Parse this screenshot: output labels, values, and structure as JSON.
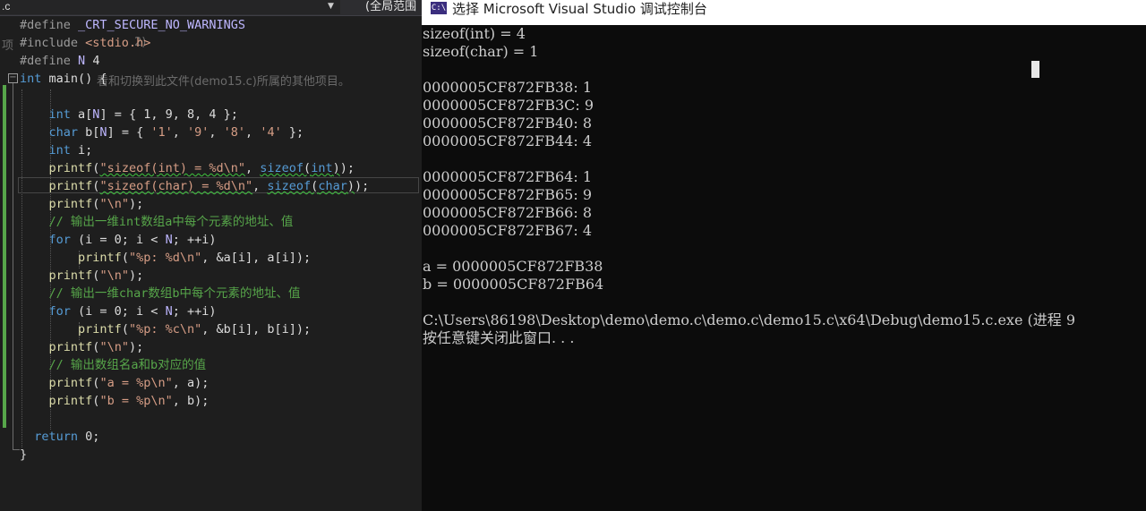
{
  "editor": {
    "file_tab": ".c",
    "scope_combo": "(全局范围",
    "tooltip_text_1": "项",
    "tooltip_text_1b": "2)",
    "tooltip_text_2": "看和切换到此文件(demo15.c)所属的其他项目。",
    "collapse_symbol": "−",
    "lines": [
      {
        "name": "line-define-crt",
        "html": "<span class=\"pp\">#define</span> <span class=\"mac\">_CRT_SECURE_NO_WARNINGS</span>"
      },
      {
        "name": "line-include",
        "html": "<span class=\"pp\">#include</span> <span class=\"str\">&lt;stdio.h&gt;</span>"
      },
      {
        "name": "line-define-n",
        "html": "<span class=\"pp\">#define</span> <span class=\"mac\">N</span> 4"
      },
      {
        "name": "line-main",
        "html": "<span class=\"kw\">int</span> main() {"
      },
      {
        "name": "line-blank-1",
        "html": ""
      },
      {
        "name": "line-decl-a",
        "html": "    <span class=\"kw\">int</span> a[<span class=\"mac\">N</span>] = { 1, 9, 8, 4 };"
      },
      {
        "name": "line-decl-b",
        "html": "    <span class=\"kw\">char</span> b[<span class=\"mac\">N</span>] = { <span class=\"str\">'1'</span>, <span class=\"str\">'9'</span>, <span class=\"str\">'8'</span>, <span class=\"str\">'4'</span> };"
      },
      {
        "name": "line-decl-i",
        "html": "    <span class=\"kw\">int</span> i;"
      },
      {
        "name": "line-printf-sizeof-int",
        "html": "    <span class=\"fn\">printf</span>(<span class=\"str err\">\"sizeof(int) = %d\\n\"</span>, <span class=\"kw err\">sizeof</span><span class=\"err\">(</span><span class=\"kw err\">int</span><span class=\"err\">)</span>);"
      },
      {
        "name": "line-printf-sizeof-char",
        "html": "    <span class=\"fn\">printf</span>(<span class=\"str err\">\"sizeof(char) = %d\\n\"</span>, <span class=\"kw err\">sizeof</span><span class=\"err\">(</span><span class=\"kw err\">char</span><span class=\"err\">)</span>);"
      },
      {
        "name": "line-printf-newline-1",
        "html": "    <span class=\"fn\">printf</span>(<span class=\"str\">\"\\n\"</span>);"
      },
      {
        "name": "line-comment-1",
        "html": "    <span class=\"cm\">// 输出一维int数组a中每个元素的地址、值</span>"
      },
      {
        "name": "line-for-1",
        "html": "    <span class=\"kw\">for</span> (i = 0; i &lt; <span class=\"mac\">N</span>; ++i)"
      },
      {
        "name": "line-printf-a",
        "html": "        <span class=\"fn\">printf</span>(<span class=\"str\">\"%p: %d\\n\"</span>, &amp;a[i], a[i]);"
      },
      {
        "name": "line-printf-newline-2",
        "html": "    <span class=\"fn\">printf</span>(<span class=\"str\">\"\\n\"</span>);"
      },
      {
        "name": "line-comment-2",
        "html": "    <span class=\"cm\">// 输出一维char数组b中每个元素的地址、值</span>"
      },
      {
        "name": "line-for-2",
        "html": "    <span class=\"kw\">for</span> (i = 0; i &lt; <span class=\"mac\">N</span>; ++i)"
      },
      {
        "name": "line-printf-b",
        "html": "        <span class=\"fn\">printf</span>(<span class=\"str\">\"%p: %c\\n\"</span>, &amp;b[i], b[i]);"
      },
      {
        "name": "line-printf-newline-3",
        "html": "    <span class=\"fn\">printf</span>(<span class=\"str\">\"\\n\"</span>);"
      },
      {
        "name": "line-comment-3",
        "html": "    <span class=\"cm\">// 输出数组名a和b对应的值</span>"
      },
      {
        "name": "line-printf-pa",
        "html": "    <span class=\"fn\">printf</span>(<span class=\"str\">\"a = %p\\n\"</span>, a);"
      },
      {
        "name": "line-printf-pb",
        "html": "    <span class=\"fn\">printf</span>(<span class=\"str\">\"b = %p\\n\"</span>, b);"
      },
      {
        "name": "line-blank-2",
        "html": ""
      },
      {
        "name": "line-return",
        "html": "  <span class=\"kw\">return</span> 0;"
      },
      {
        "name": "line-close-brace",
        "html": "}"
      }
    ]
  },
  "console": {
    "icon_text": "C:\\",
    "title": "选择 Microsoft Visual Studio 调试控制台",
    "output": [
      "sizeof(int) = 4",
      "sizeof(char) = 1",
      "",
      "0000005CF872FB38: 1",
      "0000005CF872FB3C: 9",
      "0000005CF872FB40: 8",
      "0000005CF872FB44: 4",
      "",
      "0000005CF872FB64: 1",
      "0000005CF872FB65: 9",
      "0000005CF872FB66: 8",
      "0000005CF872FB67: 4",
      "",
      "a = 0000005CF872FB38",
      "b = 0000005CF872FB64",
      "",
      "C:\\Users\\86198\\Desktop\\demo\\demo.c\\demo.c\\demo15.c\\x64\\Debug\\demo15.c.exe (进程 9",
      "按任意键关闭此窗口. . ."
    ]
  }
}
